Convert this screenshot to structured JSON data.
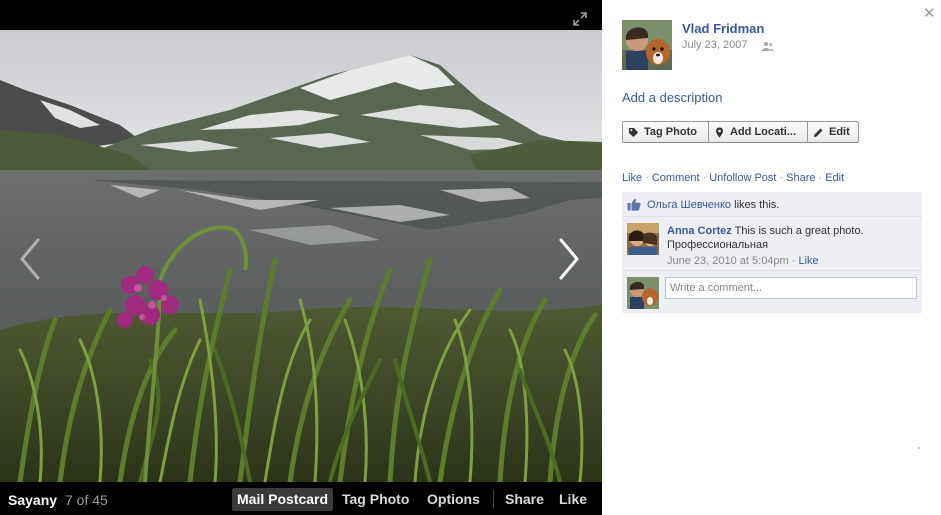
{
  "photo_bar": {
    "album": "Sayany",
    "counter": "7 of 45",
    "buttons": {
      "mail_postcard": "Mail Postcard",
      "tag_photo": "Tag Photo",
      "options": "Options",
      "share": "Share",
      "like": "Like"
    }
  },
  "photo": {
    "icons": [
      "expand-icon",
      "previous-arrow-icon",
      "next-arrow-icon"
    ]
  },
  "owner": {
    "name": "Vlad Fridman",
    "date": "July 23, 2007",
    "privacy_icon": "friends-icon"
  },
  "add_description": "Add a description",
  "buttons": {
    "tag_photo": "Tag Photo",
    "add_location": "Add Locati...",
    "edit": "Edit"
  },
  "actions": {
    "like": "Like",
    "comment": "Comment",
    "unfollow": "Unfollow Post",
    "share": "Share",
    "edit": "Edit",
    "separator": "·"
  },
  "likes": {
    "liker": "Ольга Шевченко",
    "text": "likes this."
  },
  "comments": [
    {
      "author": "Anna Cortez",
      "text": "This is such a great photo. Профессиональная",
      "time": "June 23, 2010 at 5:04pm",
      "like": "Like"
    }
  ],
  "composer": {
    "placeholder": "Write a comment..."
  },
  "colors": {
    "link": "#3b5998",
    "feedback_bg": "#edeff4",
    "stage_bg": "#000000"
  }
}
